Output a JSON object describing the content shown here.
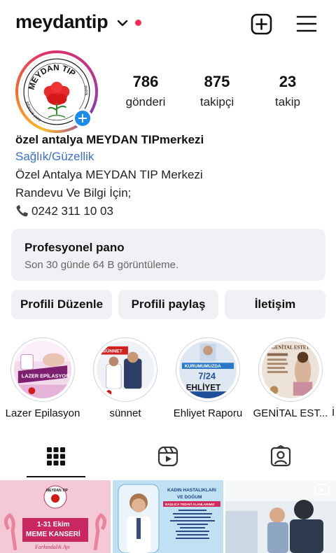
{
  "header": {
    "username": "meydantip",
    "icons": [
      "chevron-down-icon",
      "notification-dot",
      "create-plus-icon",
      "hamburger-menu-icon"
    ],
    "accent_dot_color": "#ff2a55"
  },
  "profile": {
    "avatar_text_top": "MEYDAN TIP",
    "avatar_text_left": "özel antalya",
    "avatar_text_right": "merk",
    "stats": [
      {
        "value": "786",
        "label": "gönderi"
      },
      {
        "value": "875",
        "label": "takipçi"
      },
      {
        "value": "23",
        "label": "takip"
      }
    ],
    "name": "özel antalya MEYDAN TIPmerkezi",
    "category": "Sağlık/Güzellik",
    "bio_line1": "Özel Antalya MEYDAN TIP Merkezi",
    "bio_line2": "Randevu Ve Bilgi İçin;",
    "phone": "0242 311 10 03",
    "link_color": "#3b6fd0"
  },
  "dashboard": {
    "title": "Profesyonel pano",
    "subtitle": "Son 30 günde 64 B görüntüleme."
  },
  "actions": {
    "edit": "Profili Düzenle",
    "share": "Profili paylaş",
    "contact": "İletişim"
  },
  "highlights": [
    {
      "caption": "Lazer Epilasyon",
      "pic_text": "LAZER EPİLASYON"
    },
    {
      "caption": "sünnet",
      "pic_text": "SÜNNET"
    },
    {
      "caption": "Ehliyet Raporu",
      "pic_text_1": "KURUMUMUZDA",
      "pic_text_2": "7/24",
      "pic_text_3": "EHLİYET"
    },
    {
      "caption": "GENİTAL EST...",
      "pic_text": "GENİTAL ESTETİK"
    },
    {
      "caption": "İ"
    }
  ],
  "tabs": [
    "grid-icon",
    "reels-icon",
    "tagged-icon"
  ],
  "posts": [
    {
      "line1": "1-31 Ekim",
      "line2": "MEME KANSERİ",
      "line3": "Farkındalık Ayı",
      "logo": "MEYDAN TIP"
    },
    {
      "title1": "KADIN HASTALIKLARI",
      "title2": "VE DOĞUM",
      "banner": "BAŞLICA TEDAVİ ALANLARIMIZ"
    },
    {
      "type": "reel"
    }
  ]
}
